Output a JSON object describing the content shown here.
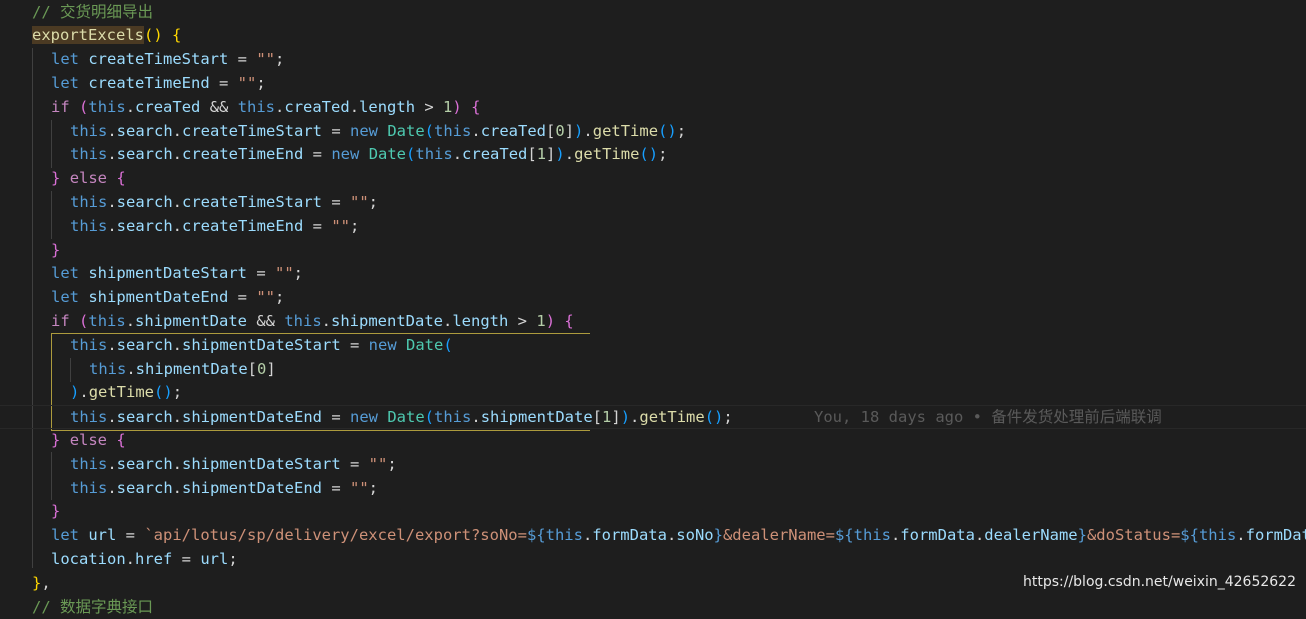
{
  "editor": {
    "lines": [
      {
        "indent": 32,
        "tokens": [
          [
            "c-comment",
            "// 交货明细导出"
          ]
        ]
      },
      {
        "indent": 32,
        "tokens": [
          [
            "c-fn hl-name",
            "exportExcels"
          ],
          [
            "c-p1",
            "()"
          ],
          [
            "c-op",
            " "
          ],
          [
            "c-p1",
            "{"
          ]
        ]
      },
      {
        "indent": 51,
        "tokens": [
          [
            "c-kw",
            "let"
          ],
          [
            "c-op",
            " "
          ],
          [
            "c-var",
            "createTimeStart"
          ],
          [
            "c-op",
            " = "
          ],
          [
            "c-str",
            "\"\""
          ],
          [
            "c-op",
            ";"
          ]
        ]
      },
      {
        "indent": 51,
        "tokens": [
          [
            "c-kw",
            "let"
          ],
          [
            "c-op",
            " "
          ],
          [
            "c-var",
            "createTimeEnd"
          ],
          [
            "c-op",
            " = "
          ],
          [
            "c-str",
            "\"\""
          ],
          [
            "c-op",
            ";"
          ]
        ]
      },
      {
        "indent": 51,
        "tokens": [
          [
            "c-ctrl",
            "if"
          ],
          [
            "c-op",
            " "
          ],
          [
            "c-p2",
            "("
          ],
          [
            "c-kw",
            "this"
          ],
          [
            "c-op",
            "."
          ],
          [
            "c-var",
            "creaTed"
          ],
          [
            "c-op",
            " && "
          ],
          [
            "c-kw",
            "this"
          ],
          [
            "c-op",
            "."
          ],
          [
            "c-var",
            "creaTed"
          ],
          [
            "c-op",
            "."
          ],
          [
            "c-var",
            "length"
          ],
          [
            "c-op",
            " > "
          ],
          [
            "c-num",
            "1"
          ],
          [
            "c-p2",
            ")"
          ],
          [
            "c-op",
            " "
          ],
          [
            "c-p2",
            "{"
          ]
        ]
      },
      {
        "indent": 70,
        "tokens": [
          [
            "c-kw",
            "this"
          ],
          [
            "c-op",
            "."
          ],
          [
            "c-var",
            "search"
          ],
          [
            "c-op",
            "."
          ],
          [
            "c-var",
            "createTimeStart"
          ],
          [
            "c-op",
            " = "
          ],
          [
            "c-kw",
            "new"
          ],
          [
            "c-op",
            " "
          ],
          [
            "c-cls",
            "Date"
          ],
          [
            "c-p3",
            "("
          ],
          [
            "c-kw",
            "this"
          ],
          [
            "c-op",
            "."
          ],
          [
            "c-var",
            "creaTed"
          ],
          [
            "c-op",
            "["
          ],
          [
            "c-num",
            "0"
          ],
          [
            "c-op",
            "]"
          ],
          [
            "c-p3",
            ")"
          ],
          [
            "c-op",
            "."
          ],
          [
            "c-fn",
            "getTime"
          ],
          [
            "c-p3",
            "()"
          ],
          [
            "c-op",
            ";"
          ]
        ]
      },
      {
        "indent": 70,
        "tokens": [
          [
            "c-kw",
            "this"
          ],
          [
            "c-op",
            "."
          ],
          [
            "c-var",
            "search"
          ],
          [
            "c-op",
            "."
          ],
          [
            "c-var",
            "createTimeEnd"
          ],
          [
            "c-op",
            " = "
          ],
          [
            "c-kw",
            "new"
          ],
          [
            "c-op",
            " "
          ],
          [
            "c-cls",
            "Date"
          ],
          [
            "c-p3",
            "("
          ],
          [
            "c-kw",
            "this"
          ],
          [
            "c-op",
            "."
          ],
          [
            "c-var",
            "creaTed"
          ],
          [
            "c-op",
            "["
          ],
          [
            "c-num",
            "1"
          ],
          [
            "c-op",
            "]"
          ],
          [
            "c-p3",
            ")"
          ],
          [
            "c-op",
            "."
          ],
          [
            "c-fn",
            "getTime"
          ],
          [
            "c-p3",
            "()"
          ],
          [
            "c-op",
            ";"
          ]
        ]
      },
      {
        "indent": 51,
        "tokens": [
          [
            "c-p2",
            "}"
          ],
          [
            "c-op",
            " "
          ],
          [
            "c-ctrl",
            "else"
          ],
          [
            "c-op",
            " "
          ],
          [
            "c-p2",
            "{"
          ]
        ]
      },
      {
        "indent": 70,
        "tokens": [
          [
            "c-kw",
            "this"
          ],
          [
            "c-op",
            "."
          ],
          [
            "c-var",
            "search"
          ],
          [
            "c-op",
            "."
          ],
          [
            "c-var",
            "createTimeStart"
          ],
          [
            "c-op",
            " = "
          ],
          [
            "c-str",
            "\"\""
          ],
          [
            "c-op",
            ";"
          ]
        ]
      },
      {
        "indent": 70,
        "tokens": [
          [
            "c-kw",
            "this"
          ],
          [
            "c-op",
            "."
          ],
          [
            "c-var",
            "search"
          ],
          [
            "c-op",
            "."
          ],
          [
            "c-var",
            "createTimeEnd"
          ],
          [
            "c-op",
            " = "
          ],
          [
            "c-str",
            "\"\""
          ],
          [
            "c-op",
            ";"
          ]
        ]
      },
      {
        "indent": 51,
        "tokens": [
          [
            "c-p2",
            "}"
          ]
        ]
      },
      {
        "indent": 51,
        "tokens": [
          [
            "c-kw",
            "let"
          ],
          [
            "c-op",
            " "
          ],
          [
            "c-var",
            "shipmentDateStart"
          ],
          [
            "c-op",
            " = "
          ],
          [
            "c-str",
            "\"\""
          ],
          [
            "c-op",
            ";"
          ]
        ]
      },
      {
        "indent": 51,
        "tokens": [
          [
            "c-kw",
            "let"
          ],
          [
            "c-op",
            " "
          ],
          [
            "c-var",
            "shipmentDateEnd"
          ],
          [
            "c-op",
            " = "
          ],
          [
            "c-str",
            "\"\""
          ],
          [
            "c-op",
            ";"
          ]
        ]
      },
      {
        "indent": 51,
        "tokens": [
          [
            "c-ctrl",
            "if"
          ],
          [
            "c-op",
            " "
          ],
          [
            "c-p2",
            "("
          ],
          [
            "c-kw",
            "this"
          ],
          [
            "c-op",
            "."
          ],
          [
            "c-var",
            "shipmentDate"
          ],
          [
            "c-op",
            " && "
          ],
          [
            "c-kw",
            "this"
          ],
          [
            "c-op",
            "."
          ],
          [
            "c-var",
            "shipmentDate"
          ],
          [
            "c-op",
            "."
          ],
          [
            "c-var",
            "length"
          ],
          [
            "c-op",
            " > "
          ],
          [
            "c-num",
            "1"
          ],
          [
            "c-p2",
            ")"
          ],
          [
            "c-op",
            " "
          ],
          [
            "c-p2",
            "{"
          ]
        ]
      },
      {
        "indent": 70,
        "tokens": [
          [
            "c-kw",
            "this"
          ],
          [
            "c-op",
            "."
          ],
          [
            "c-var",
            "search"
          ],
          [
            "c-op",
            "."
          ],
          [
            "c-var",
            "shipmentDateStart"
          ],
          [
            "c-op",
            " = "
          ],
          [
            "c-kw",
            "new"
          ],
          [
            "c-op",
            " "
          ],
          [
            "c-cls",
            "Date"
          ],
          [
            "c-p3",
            "("
          ]
        ]
      },
      {
        "indent": 89,
        "tokens": [
          [
            "c-kw",
            "this"
          ],
          [
            "c-op",
            "."
          ],
          [
            "c-var",
            "shipmentDate"
          ],
          [
            "c-op",
            "["
          ],
          [
            "c-num",
            "0"
          ],
          [
            "c-op",
            "]"
          ]
        ]
      },
      {
        "indent": 70,
        "tokens": [
          [
            "c-p3",
            ")"
          ],
          [
            "c-op",
            "."
          ],
          [
            "c-fn",
            "getTime"
          ],
          [
            "c-p3",
            "()"
          ],
          [
            "c-op",
            ";"
          ]
        ]
      },
      {
        "indent": 70,
        "current": true,
        "tokens": [
          [
            "c-kw",
            "this"
          ],
          [
            "c-op",
            "."
          ],
          [
            "c-var",
            "search"
          ],
          [
            "c-op",
            "."
          ],
          [
            "c-var",
            "shipmentDateEnd"
          ],
          [
            "c-op",
            " = "
          ],
          [
            "c-kw",
            "new"
          ],
          [
            "c-op",
            " "
          ],
          [
            "c-cls",
            "Date"
          ],
          [
            "c-p3",
            "("
          ],
          [
            "c-kw",
            "this"
          ],
          [
            "c-op",
            "."
          ],
          [
            "c-var",
            "shipmentDate"
          ],
          [
            "c-op",
            "["
          ],
          [
            "c-num",
            "1"
          ],
          [
            "c-op",
            "]"
          ],
          [
            "c-p3",
            ")"
          ],
          [
            "c-op",
            "."
          ],
          [
            "c-fn",
            "getTime"
          ],
          [
            "c-p3",
            "()"
          ],
          [
            "c-op",
            ";"
          ]
        ],
        "blame": "You, 18 days ago • 备件发货处理前后端联调"
      },
      {
        "indent": 51,
        "tokens": [
          [
            "c-p2",
            "}"
          ],
          [
            "c-op",
            " "
          ],
          [
            "c-ctrl",
            "else"
          ],
          [
            "c-op",
            " "
          ],
          [
            "c-p2",
            "{"
          ]
        ]
      },
      {
        "indent": 70,
        "tokens": [
          [
            "c-kw",
            "this"
          ],
          [
            "c-op",
            "."
          ],
          [
            "c-var",
            "search"
          ],
          [
            "c-op",
            "."
          ],
          [
            "c-var",
            "shipmentDateStart"
          ],
          [
            "c-op",
            " = "
          ],
          [
            "c-str",
            "\"\""
          ],
          [
            "c-op",
            ";"
          ]
        ]
      },
      {
        "indent": 70,
        "tokens": [
          [
            "c-kw",
            "this"
          ],
          [
            "c-op",
            "."
          ],
          [
            "c-var",
            "search"
          ],
          [
            "c-op",
            "."
          ],
          [
            "c-var",
            "shipmentDateEnd"
          ],
          [
            "c-op",
            " = "
          ],
          [
            "c-str",
            "\"\""
          ],
          [
            "c-op",
            ";"
          ]
        ]
      },
      {
        "indent": 51,
        "tokens": [
          [
            "c-p2",
            "}"
          ]
        ]
      },
      {
        "indent": 51,
        "tokens": [
          [
            "c-kw",
            "let"
          ],
          [
            "c-op",
            " "
          ],
          [
            "c-var",
            "url"
          ],
          [
            "c-op",
            " = "
          ],
          [
            "c-str",
            "`api/lotus/sp/delivery/excel/export?soNo="
          ],
          [
            "c-kw",
            "${"
          ],
          [
            "c-kw",
            "this"
          ],
          [
            "c-op",
            "."
          ],
          [
            "c-var",
            "formData"
          ],
          [
            "c-op",
            "."
          ],
          [
            "c-var",
            "soNo"
          ],
          [
            "c-kw",
            "}"
          ],
          [
            "c-str",
            "&dealerName="
          ],
          [
            "c-kw",
            "${"
          ],
          [
            "c-kw",
            "this"
          ],
          [
            "c-op",
            "."
          ],
          [
            "c-var",
            "formData"
          ],
          [
            "c-op",
            "."
          ],
          [
            "c-var",
            "dealerName"
          ],
          [
            "c-kw",
            "}"
          ],
          [
            "c-str",
            "&doStatus="
          ],
          [
            "c-kw",
            "${"
          ],
          [
            "c-kw",
            "this"
          ],
          [
            "c-op",
            "."
          ],
          [
            "c-var",
            "formData"
          ]
        ]
      },
      {
        "indent": 51,
        "tokens": [
          [
            "c-var",
            "location"
          ],
          [
            "c-op",
            "."
          ],
          [
            "c-var",
            "href"
          ],
          [
            "c-op",
            " = "
          ],
          [
            "c-var",
            "url"
          ],
          [
            "c-op",
            ";"
          ]
        ]
      },
      {
        "indent": 32,
        "tokens": [
          [
            "c-p1",
            "}"
          ],
          [
            "c-op",
            ","
          ]
        ]
      },
      {
        "indent": 32,
        "tokens": [
          [
            "c-comment",
            "// 数据字典接口"
          ]
        ]
      }
    ]
  },
  "watermark": "https://blog.csdn.net/weixin_42652622"
}
